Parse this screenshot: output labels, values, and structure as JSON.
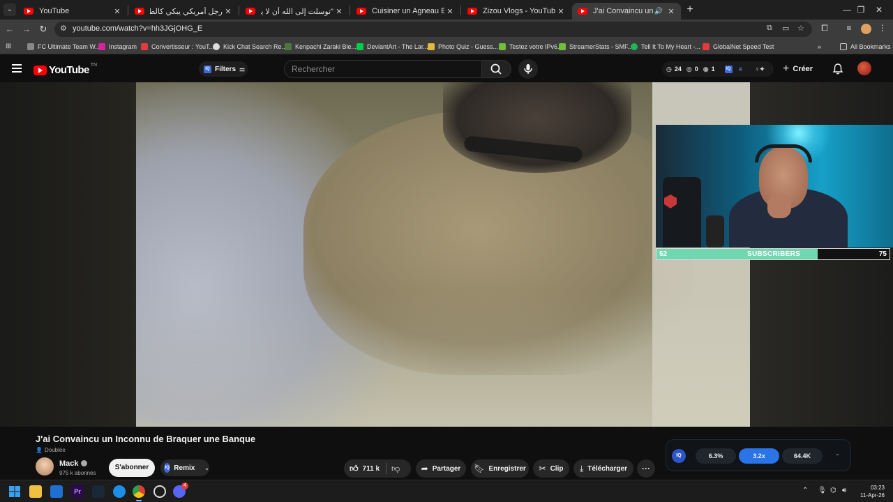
{
  "browser": {
    "tabs": [
      {
        "title": "YouTube",
        "active": false
      },
      {
        "title": "رجل أمريكي يبكي كالطفل عندما",
        "active": false
      },
      {
        "title": "\"توسلت إلى الله أن لا يكون الإسلا",
        "active": false
      },
      {
        "title": "Cuisiner un Agneau Entier sous",
        "active": false
      },
      {
        "title": "Zizou Vlogs - YouTube",
        "active": false
      },
      {
        "title": "J'ai Convaincu un Inconnu d",
        "active": true
      }
    ],
    "url": "youtube.com/watch?v=hh3JGjOHG_E",
    "bookmarks": [
      {
        "label": "FC Ultimate Team W...",
        "color": "#888888"
      },
      {
        "label": "Instagram",
        "color": "#d6249f"
      },
      {
        "label": "Convertisseur : YouT...",
        "color": "#e33b3b"
      },
      {
        "label": "Kick Chat Search Re...",
        "color": "#dddddd"
      },
      {
        "label": "Kenpachi Zaraki Ble...",
        "color": "#4a7a3a"
      },
      {
        "label": "DeviantArt - The Lar...",
        "color": "#05cc47"
      },
      {
        "label": "Photo Quiz - Guess...",
        "color": "#e2b93b"
      },
      {
        "label": "Testez votre IPv6.",
        "color": "#6fbf3b"
      },
      {
        "label": "StreamerStats - SMF...",
        "color": "#6fbf3b"
      },
      {
        "label": "Tell It To My Heart -...",
        "color": "#1db954"
      },
      {
        "label": "GlobalNet Speed Test",
        "color": "#e33b3b"
      }
    ],
    "all_bookmarks": "All Bookmarks"
  },
  "youtube": {
    "logo_text": "YouTube",
    "logo_region": "TN",
    "filters_label": "Filters",
    "search_placeholder": "Rechercher",
    "stats": {
      "a": "24",
      "b": "0",
      "c": "1"
    },
    "create_label": "Créer"
  },
  "overlay": {
    "current": "52",
    "label": "SUBSCRIBERS",
    "goal": "75",
    "progress": 0.693
  },
  "video": {
    "title": "J'ai Convaincu un Inconnu de Braquer une Banque",
    "dub_badge": "Doublée",
    "channel": "Mack",
    "subscribers": "975 k abonnés",
    "subscribe_label": "S'abonner",
    "remix_label": "Remix",
    "likes": "711 k",
    "share_label": "Partager",
    "save_label": "Enregistrer",
    "clip_label": "Clip",
    "download_label": "Télécharger"
  },
  "iq_panel": {
    "logo": "IQ",
    "stat1": "6.3%",
    "stat2": "3.2x",
    "stat3": "64.4K"
  },
  "taskbar": {
    "time": "03:23",
    "date": "11-Apr-26",
    "discord_badge": "4"
  },
  "colors": {
    "accent_red": "#ff0000",
    "iq_blue": "#2a74e8",
    "overlay_fill": "#6fd8b0"
  }
}
